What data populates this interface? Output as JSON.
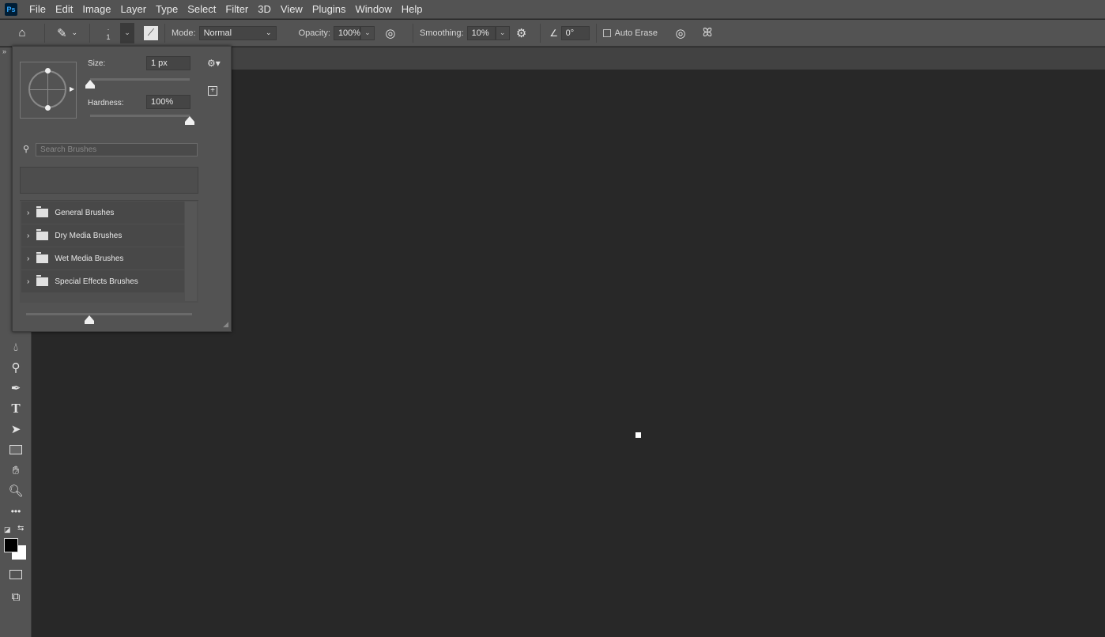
{
  "app": {
    "logo": "Ps"
  },
  "menu": [
    "File",
    "Edit",
    "Image",
    "Layer",
    "Type",
    "Select",
    "Filter",
    "3D",
    "View",
    "Plugins",
    "Window",
    "Help"
  ],
  "options": {
    "brush_size_preview": "1",
    "mode_label": "Mode:",
    "mode_value": "Normal",
    "opacity_label": "Opacity:",
    "opacity_value": "100%",
    "smoothing_label": "Smoothing:",
    "smoothing_value": "10%",
    "angle_value": "0°",
    "auto_erase_label": "Auto Erase",
    "auto_erase_checked": false
  },
  "brush_panel": {
    "size_label": "Size:",
    "size_value": "1 px",
    "size_fraction": 0,
    "hardness_label": "Hardness:",
    "hardness_value": "100%",
    "hardness_fraction": 1,
    "search_placeholder": "Search Brushes",
    "preview_size_fraction": 0.38,
    "groups": [
      "General Brushes",
      "Dry Media Brushes",
      "Wet Media Brushes",
      "Special Effects Brushes"
    ]
  },
  "colors": {
    "foreground": "#000000",
    "background": "#ffffff"
  }
}
